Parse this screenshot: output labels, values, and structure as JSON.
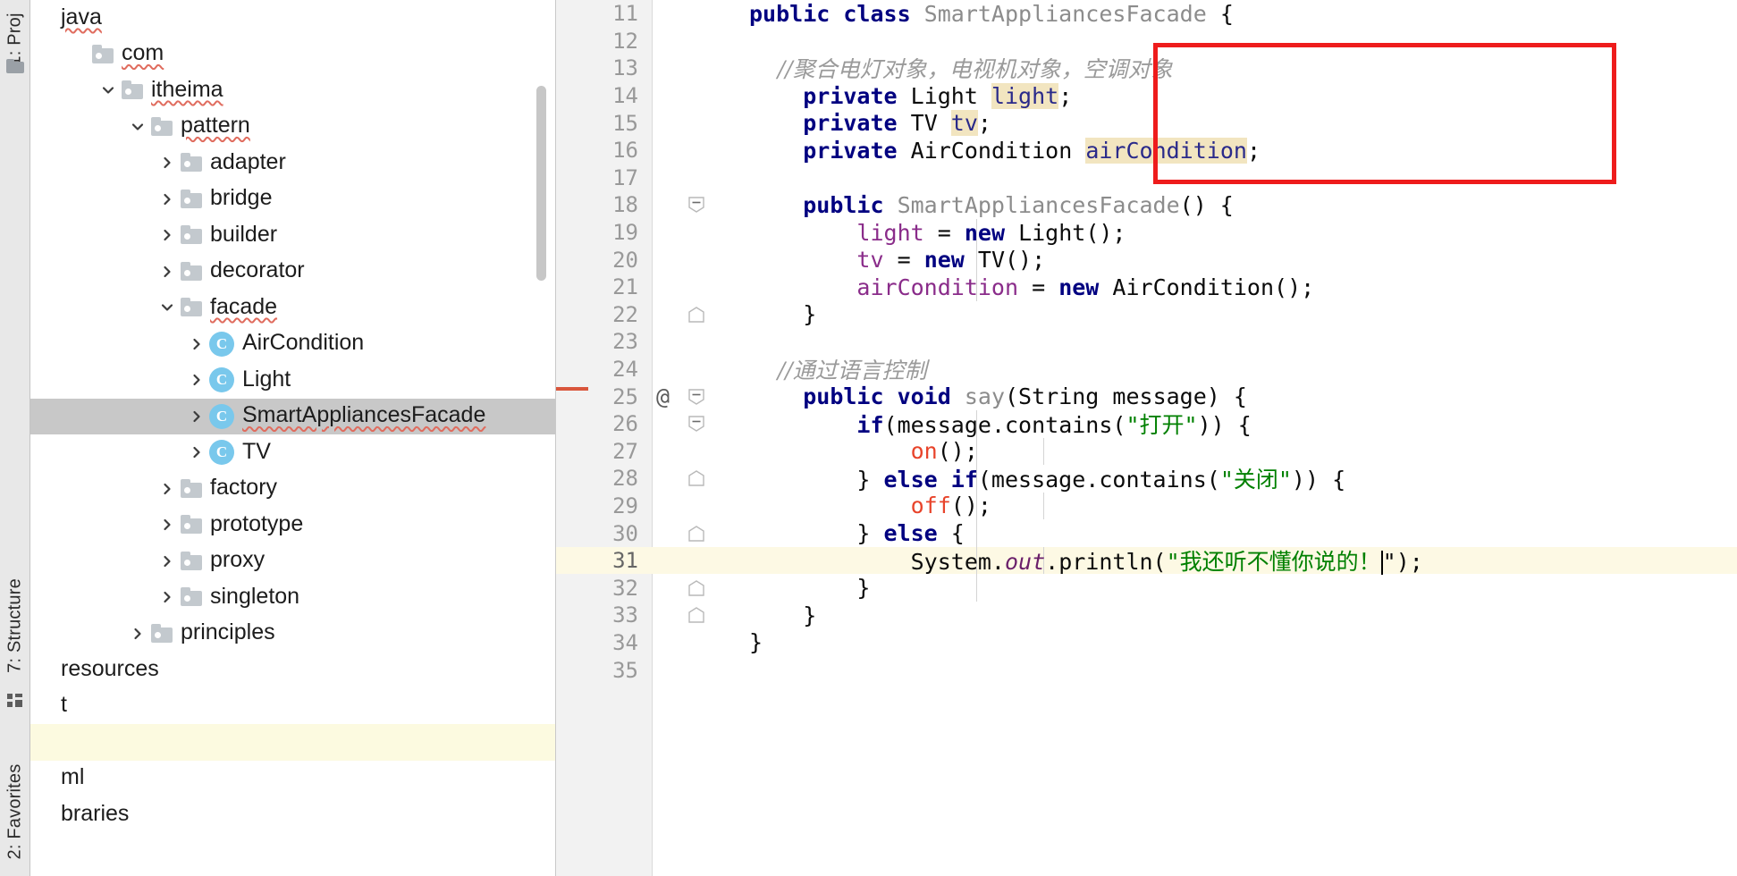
{
  "toolwindows": {
    "project_tab": "1: Proj",
    "structure_tab": "7: Structure",
    "favorites_tab": "2: Favorites",
    "folder_icon": "folder-icon",
    "grid_icon": "grid-icon"
  },
  "project_tree": {
    "items": [
      {
        "label": "java",
        "type": "source-root",
        "indent": 0,
        "arrow": "none",
        "icon": "none",
        "squiggle": true,
        "selected": false
      },
      {
        "label": "com",
        "type": "package",
        "indent": 1,
        "arrow": "none",
        "icon": "folder",
        "squiggle": true,
        "selected": false
      },
      {
        "label": "itheima",
        "type": "package",
        "indent": 2,
        "arrow": "expanded",
        "icon": "folder",
        "squiggle": true,
        "selected": false
      },
      {
        "label": "pattern",
        "type": "package",
        "indent": 3,
        "arrow": "expanded",
        "icon": "folder",
        "squiggle": true,
        "selected": false
      },
      {
        "label": "adapter",
        "type": "package",
        "indent": 4,
        "arrow": "collapsed",
        "icon": "folder",
        "squiggle": false,
        "selected": false
      },
      {
        "label": "bridge",
        "type": "package",
        "indent": 4,
        "arrow": "collapsed",
        "icon": "folder",
        "squiggle": false,
        "selected": false
      },
      {
        "label": "builder",
        "type": "package",
        "indent": 4,
        "arrow": "collapsed",
        "icon": "folder",
        "squiggle": false,
        "selected": false
      },
      {
        "label": "decorator",
        "type": "package",
        "indent": 4,
        "arrow": "collapsed",
        "icon": "folder",
        "squiggle": false,
        "selected": false
      },
      {
        "label": "facade",
        "type": "package",
        "indent": 4,
        "arrow": "expanded",
        "icon": "folder",
        "squiggle": true,
        "selected": false
      },
      {
        "label": "AirCondition",
        "type": "class",
        "indent": 5,
        "arrow": "collapsed",
        "icon": "class",
        "squiggle": false,
        "selected": false
      },
      {
        "label": "Light",
        "type": "class",
        "indent": 5,
        "arrow": "collapsed",
        "icon": "class",
        "squiggle": false,
        "selected": false
      },
      {
        "label": "SmartAppliancesFacade",
        "type": "class",
        "indent": 5,
        "arrow": "collapsed",
        "icon": "class",
        "squiggle": true,
        "selected": true
      },
      {
        "label": "TV",
        "type": "class",
        "indent": 5,
        "arrow": "collapsed",
        "icon": "class",
        "squiggle": false,
        "selected": false
      },
      {
        "label": "factory",
        "type": "package",
        "indent": 4,
        "arrow": "collapsed",
        "icon": "folder",
        "squiggle": false,
        "selected": false
      },
      {
        "label": "prototype",
        "type": "package",
        "indent": 4,
        "arrow": "collapsed",
        "icon": "folder",
        "squiggle": false,
        "selected": false
      },
      {
        "label": "proxy",
        "type": "package",
        "indent": 4,
        "arrow": "collapsed",
        "icon": "folder",
        "squiggle": false,
        "selected": false
      },
      {
        "label": "singleton",
        "type": "package",
        "indent": 4,
        "arrow": "collapsed",
        "icon": "folder",
        "squiggle": false,
        "selected": false
      },
      {
        "label": "principles",
        "type": "package",
        "indent": 3,
        "arrow": "collapsed",
        "icon": "folder",
        "squiggle": false,
        "selected": false
      },
      {
        "label": "resources",
        "type": "folder",
        "indent": 0,
        "arrow": "none",
        "icon": "none",
        "squiggle": false,
        "selected": false
      },
      {
        "label": "t",
        "type": "folder",
        "indent": 0,
        "arrow": "none",
        "icon": "none",
        "squiggle": false,
        "selected": false
      },
      {
        "label": "",
        "type": "folder",
        "indent": 0,
        "arrow": "none",
        "icon": "none",
        "squiggle": false,
        "selected": false
      },
      {
        "label": "ml",
        "type": "file",
        "indent": 0,
        "arrow": "none",
        "icon": "none",
        "squiggle": false,
        "selected": false
      },
      {
        "label": "braries",
        "type": "node",
        "indent": 0,
        "arrow": "none",
        "icon": "none",
        "squiggle": false,
        "selected": false
      }
    ]
  },
  "editor": {
    "annotation": {
      "type": "red-rectangle",
      "color": "#ee1c1c"
    },
    "caret_line_number": 31,
    "lines": [
      {
        "num": "11",
        "at": "",
        "fold": "",
        "tokens": [
          {
            "t": "public ",
            "c": "kw"
          },
          {
            "t": "class ",
            "c": "kw"
          },
          {
            "t": "SmartAppliancesFacade ",
            "c": "cls"
          },
          {
            "t": "{",
            "c": "plain"
          }
        ],
        "indent_guides": []
      },
      {
        "num": "12",
        "at": "",
        "fold": "",
        "tokens": [],
        "indent_guides": []
      },
      {
        "num": "13",
        "at": "",
        "fold": "",
        "tokens": [
          {
            "t": "    //聚合电灯对象，电视机对象，空调对象",
            "c": "cmt"
          }
        ],
        "indent_guides": []
      },
      {
        "num": "14",
        "at": "",
        "fold": "",
        "tokens": [
          {
            "t": "    ",
            "c": "plain"
          },
          {
            "t": "private ",
            "c": "kw"
          },
          {
            "t": "Light ",
            "c": "plain"
          },
          {
            "t": "light",
            "c": "fld-hl"
          },
          {
            "t": ";",
            "c": "plain"
          }
        ],
        "indent_guides": []
      },
      {
        "num": "15",
        "at": "",
        "fold": "",
        "tokens": [
          {
            "t": "    ",
            "c": "plain"
          },
          {
            "t": "private ",
            "c": "kw"
          },
          {
            "t": "TV ",
            "c": "plain"
          },
          {
            "t": "tv",
            "c": "fld-hl"
          },
          {
            "t": ";",
            "c": "plain"
          }
        ],
        "indent_guides": []
      },
      {
        "num": "16",
        "at": "",
        "fold": "",
        "tokens": [
          {
            "t": "    ",
            "c": "plain"
          },
          {
            "t": "private ",
            "c": "kw"
          },
          {
            "t": "AirCondition ",
            "c": "plain"
          },
          {
            "t": "airCondition",
            "c": "fld-hl"
          },
          {
            "t": ";",
            "c": "plain"
          }
        ],
        "indent_guides": []
      },
      {
        "num": "17",
        "at": "",
        "fold": "",
        "tokens": [],
        "indent_guides": []
      },
      {
        "num": "18",
        "at": "",
        "fold": "minus",
        "tokens": [
          {
            "t": "    ",
            "c": "plain"
          },
          {
            "t": "public ",
            "c": "kw"
          },
          {
            "t": "SmartAppliancesFacade",
            "c": "cls"
          },
          {
            "t": "() {",
            "c": "plain"
          }
        ],
        "indent_guides": []
      },
      {
        "num": "19",
        "at": "",
        "fold": "",
        "tokens": [
          {
            "t": "        ",
            "c": "plain"
          },
          {
            "t": "light",
            "c": "fld"
          },
          {
            "t": " = ",
            "c": "plain"
          },
          {
            "t": "new ",
            "c": "kw"
          },
          {
            "t": "Light();",
            "c": "plain"
          }
        ],
        "indent_guides": [
          470
        ]
      },
      {
        "num": "20",
        "at": "",
        "fold": "",
        "tokens": [
          {
            "t": "        ",
            "c": "plain"
          },
          {
            "t": "tv",
            "c": "fld"
          },
          {
            "t": " = ",
            "c": "plain"
          },
          {
            "t": "new ",
            "c": "kw"
          },
          {
            "t": "TV();",
            "c": "plain"
          }
        ],
        "indent_guides": [
          470
        ]
      },
      {
        "num": "21",
        "at": "",
        "fold": "",
        "tokens": [
          {
            "t": "        ",
            "c": "plain"
          },
          {
            "t": "airCondition",
            "c": "fld"
          },
          {
            "t": " = ",
            "c": "plain"
          },
          {
            "t": "new ",
            "c": "kw"
          },
          {
            "t": "AirCondition();",
            "c": "plain"
          }
        ],
        "indent_guides": [
          470
        ]
      },
      {
        "num": "22",
        "at": "",
        "fold": "arrow-up",
        "tokens": [
          {
            "t": "    }",
            "c": "plain"
          }
        ],
        "indent_guides": []
      },
      {
        "num": "23",
        "at": "",
        "fold": "",
        "tokens": [],
        "indent_guides": []
      },
      {
        "num": "24",
        "at": "",
        "fold": "",
        "tokens": [
          {
            "t": "    //通过语言控制",
            "c": "cmt"
          }
        ],
        "indent_guides": []
      },
      {
        "num": "25",
        "at": "@",
        "fold": "minus",
        "tokens": [
          {
            "t": "    ",
            "c": "plain"
          },
          {
            "t": "public ",
            "c": "kw"
          },
          {
            "t": "void ",
            "c": "kw"
          },
          {
            "t": "say",
            "c": "cls"
          },
          {
            "t": "(String message) {",
            "c": "plain"
          }
        ],
        "indent_guides": []
      },
      {
        "num": "26",
        "at": "",
        "fold": "minus",
        "tokens": [
          {
            "t": "        ",
            "c": "plain"
          },
          {
            "t": "if",
            "c": "kw"
          },
          {
            "t": "(message.contains(",
            "c": "plain"
          },
          {
            "t": "\"打开\"",
            "c": "str"
          },
          {
            "t": ")) {",
            "c": "plain"
          }
        ],
        "indent_guides": [
          470
        ]
      },
      {
        "num": "27",
        "at": "",
        "fold": "",
        "tokens": [
          {
            "t": "            ",
            "c": "plain"
          },
          {
            "t": "on",
            "c": "mth"
          },
          {
            "t": "();",
            "c": "plain"
          }
        ],
        "indent_guides": [
          470,
          545
        ]
      },
      {
        "num": "28",
        "at": "",
        "fold": "arrow-up",
        "tokens": [
          {
            "t": "        } ",
            "c": "plain"
          },
          {
            "t": "else if",
            "c": "kw"
          },
          {
            "t": "(message.contains(",
            "c": "plain"
          },
          {
            "t": "\"关闭\"",
            "c": "str"
          },
          {
            "t": ")) {",
            "c": "plain"
          }
        ],
        "indent_guides": [
          470
        ]
      },
      {
        "num": "29",
        "at": "",
        "fold": "",
        "tokens": [
          {
            "t": "            ",
            "c": "plain"
          },
          {
            "t": "off",
            "c": "mth"
          },
          {
            "t": "();",
            "c": "plain"
          }
        ],
        "indent_guides": [
          470,
          545
        ]
      },
      {
        "num": "30",
        "at": "",
        "fold": "arrow-up",
        "tokens": [
          {
            "t": "        } ",
            "c": "plain"
          },
          {
            "t": "else ",
            "c": "kw"
          },
          {
            "t": "{",
            "c": "plain"
          }
        ],
        "indent_guides": [
          470
        ]
      },
      {
        "num": "31",
        "at": "",
        "fold": "",
        "caret_after": true,
        "tokens": [
          {
            "t": "            System.",
            "c": "plain"
          },
          {
            "t": "out",
            "c": "static-it"
          },
          {
            "t": ".println(",
            "c": "plain"
          },
          {
            "t": "\"我还听不懂你说的！",
            "c": "str"
          }
        ],
        "tokens_tail": [
          {
            "t": "\");",
            "c": "plain"
          }
        ],
        "indent_guides": [
          470,
          545
        ]
      },
      {
        "num": "32",
        "at": "",
        "fold": "arrow-up",
        "tokens": [
          {
            "t": "        }",
            "c": "plain"
          }
        ],
        "indent_guides": [
          470
        ]
      },
      {
        "num": "33",
        "at": "",
        "fold": "arrow-up",
        "tokens": [
          {
            "t": "    }",
            "c": "plain"
          }
        ],
        "indent_guides": []
      },
      {
        "num": "34",
        "at": "",
        "fold": "",
        "tokens": [
          {
            "t": "}",
            "c": "plain"
          }
        ],
        "indent_guides": []
      },
      {
        "num": "35",
        "at": "",
        "fold": "",
        "tokens": [],
        "indent_guides": []
      }
    ]
  }
}
